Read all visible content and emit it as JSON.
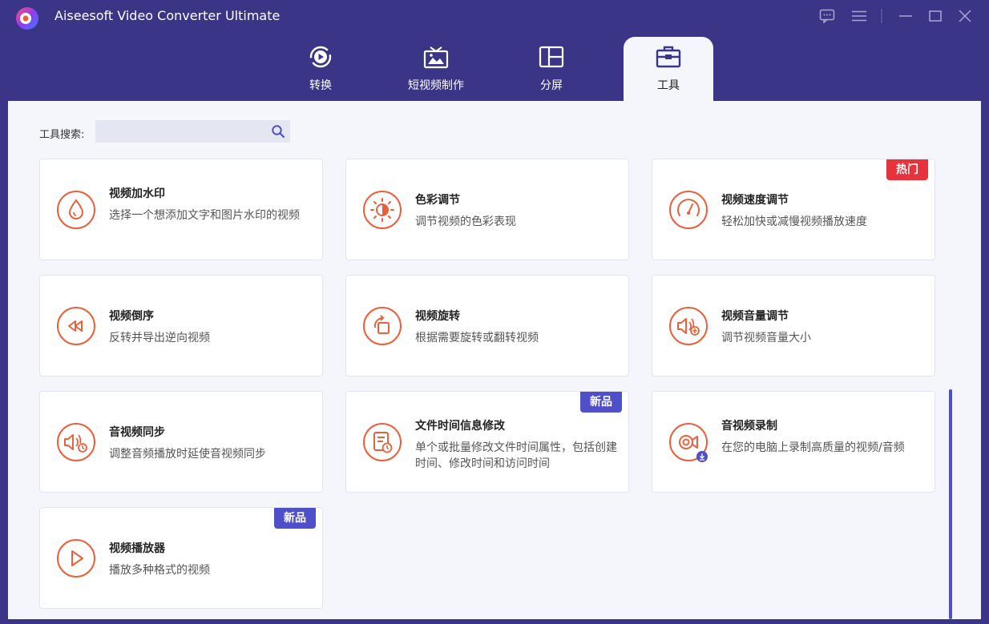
{
  "app": {
    "title": "Aiseesoft Video Converter Ultimate",
    "accent": "#3b3587",
    "icon_color": "#e8603c"
  },
  "tabs": [
    {
      "label": "转换",
      "icon": "convert-icon",
      "active": false
    },
    {
      "label": "短视频制作",
      "icon": "tv-icon",
      "active": false
    },
    {
      "label": "分屏",
      "icon": "split-screen-icon",
      "active": false
    },
    {
      "label": "工具",
      "icon": "toolbox-icon",
      "active": true
    }
  ],
  "search": {
    "label": "工具搜索:",
    "value": "",
    "placeholder": ""
  },
  "tools": [
    {
      "title": "视频加水印",
      "desc": "选择一个想添加文字和图片水印的视频",
      "icon": "watermark-icon",
      "badge": ""
    },
    {
      "title": "色彩调节",
      "desc": "调节视频的色彩表现",
      "icon": "color-adjust-icon",
      "badge": ""
    },
    {
      "title": "视频速度调节",
      "desc": "轻松加快或减慢视频播放速度",
      "icon": "speed-gauge-icon",
      "badge": "热门"
    },
    {
      "title": "视频倒序",
      "desc": "反转并导出逆向视频",
      "icon": "rewind-icon",
      "badge": ""
    },
    {
      "title": "视频旋转",
      "desc": "根据需要旋转或翻转视频",
      "icon": "rotate-icon",
      "badge": ""
    },
    {
      "title": "视频音量调节",
      "desc": "调节视频音量大小",
      "icon": "volume-icon",
      "badge": ""
    },
    {
      "title": "音视频同步",
      "desc": "调整音频播放时延使音视频同步",
      "icon": "audio-sync-icon",
      "badge": ""
    },
    {
      "title": "文件时间信息修改",
      "desc": "单个或批量修改文件时间属性，包括创建时间、修改时间和访问时间",
      "icon": "file-time-icon",
      "badge": "新品"
    },
    {
      "title": "音视频录制",
      "desc": "在您的电脑上录制高质量的视频/音频",
      "icon": "recorder-icon",
      "badge": ""
    },
    {
      "title": "视频播放器",
      "desc": "播放多种格式的视频",
      "icon": "play-icon",
      "badge": "新品"
    }
  ]
}
